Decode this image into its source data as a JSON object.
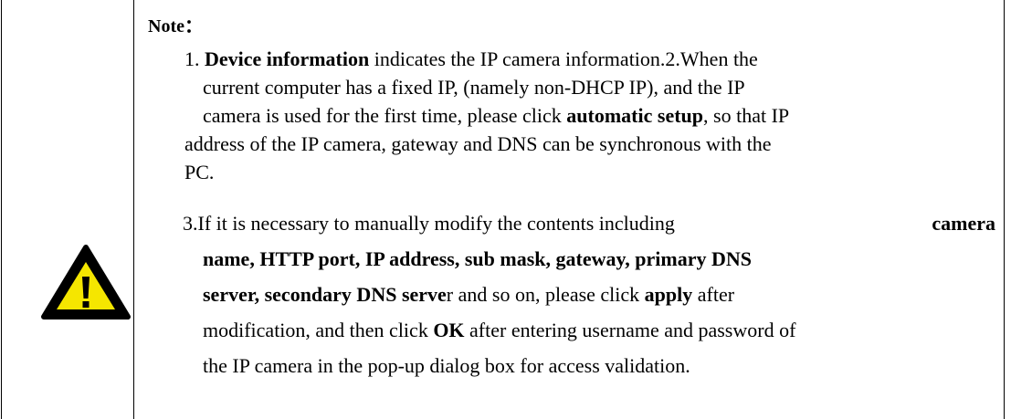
{
  "note": {
    "label": "Note：",
    "item1_prefix": "1. ",
    "item1_bold": "Device information",
    "item1_rest": " indicates the IP camera information.2.When the",
    "item2_line2": "current computer has a fixed IP, (namely non-DHCP IP), and the IP",
    "item2_line3_pre": "camera is used for the first time, please click ",
    "item2_line3_bold": "automatic setup",
    "item2_line3_post": ", so that IP",
    "item2_line4": "address of the IP camera, gateway and DNS can be synchronous with the",
    "item2_line5": "PC.",
    "item3_l1_pre": "3.If it is necessary to manually modify the contents including",
    "item3_l1_bold": "camera",
    "item3_l2_bold": "name, HTTP port, IP address, sub mask, gateway, primary DNS",
    "item3_l3_bold": "server, secondary DNS serve",
    "item3_l3_mid": "r and so on, please click ",
    "item3_l3_bold2": "apply",
    "item3_l3_post": " after",
    "item3_l4_pre": "modification, and then click ",
    "item3_l4_bold": "OK",
    "item3_l4_post": " after entering username and password of",
    "item3_l5": "the IP camera in the pop-up dialog box for access validation."
  },
  "icon": {
    "name": "warning-icon",
    "accent": "#f5e600"
  }
}
